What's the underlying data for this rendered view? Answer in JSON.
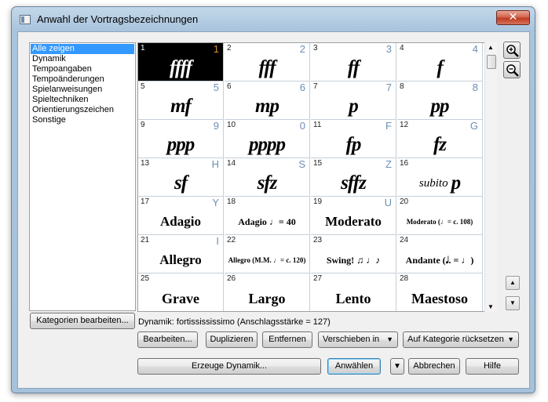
{
  "window": {
    "title": "Anwahl der Vortragsbezeichnungen",
    "close_label": "✕"
  },
  "categories": [
    "Alle zeigen",
    "Dynamik",
    "Tempoangaben",
    "Tempoänderungen",
    "Spielanweisungen",
    "Spieltechniken",
    "Orientierungszeichen",
    "Sonstige"
  ],
  "cells": [
    {
      "n": "1",
      "key": "1",
      "sym": "ffff",
      "style": "dyn"
    },
    {
      "n": "2",
      "key": "2",
      "sym": "fff",
      "style": "dyn"
    },
    {
      "n": "3",
      "key": "3",
      "sym": "ff",
      "style": "dyn"
    },
    {
      "n": "4",
      "key": "4",
      "sym": "f",
      "style": "dyn"
    },
    {
      "n": "5",
      "key": "5",
      "sym": "mf",
      "style": "dyn"
    },
    {
      "n": "6",
      "key": "6",
      "sym": "mp",
      "style": "dyn"
    },
    {
      "n": "7",
      "key": "7",
      "sym": "p",
      "style": "dyn"
    },
    {
      "n": "8",
      "key": "8",
      "sym": "pp",
      "style": "dyn"
    },
    {
      "n": "9",
      "key": "9",
      "sym": "ppp",
      "style": "dyn"
    },
    {
      "n": "10",
      "key": "0",
      "sym": "pppp",
      "style": "dyn"
    },
    {
      "n": "11",
      "key": "F",
      "sym": "fp",
      "style": "dyn"
    },
    {
      "n": "12",
      "key": "G",
      "sym": "fz",
      "style": "dyn"
    },
    {
      "n": "13",
      "key": "H",
      "sym": "sf",
      "style": "dyn"
    },
    {
      "n": "14",
      "key": "S",
      "sym": "sfz",
      "style": "dyn"
    },
    {
      "n": "15",
      "key": "Z",
      "sym": "sffz",
      "style": "dyn"
    },
    {
      "n": "16",
      "key": "",
      "sym": "p",
      "prefix": "subito",
      "style": "dyn"
    },
    {
      "n": "17",
      "key": "Y",
      "sym": "Adagio",
      "style": "tempo"
    },
    {
      "n": "18",
      "key": "",
      "sym": "Adagio ♩= 40",
      "style": "small"
    },
    {
      "n": "19",
      "key": "U",
      "sym": "Moderato",
      "style": "tempo"
    },
    {
      "n": "20",
      "key": "",
      "sym": "Moderato (♩= c. 108)",
      "style": "tiny"
    },
    {
      "n": "21",
      "key": "I",
      "sym": "Allegro",
      "style": "tempo"
    },
    {
      "n": "22",
      "key": "",
      "sym": "Allegro (M.M. ♩= c. 120)",
      "style": "tiny"
    },
    {
      "n": "23",
      "key": "",
      "sym": "Swing! ♫ ♩♪",
      "style": "small"
    },
    {
      "n": "24",
      "key": "",
      "sym": "Andante (𝅗𝅥. = ♩)",
      "style": "small"
    },
    {
      "n": "25",
      "key": "",
      "sym": "Grave",
      "style": "tempo-lg"
    },
    {
      "n": "26",
      "key": "",
      "sym": "Largo",
      "style": "tempo-lg"
    },
    {
      "n": "27",
      "key": "",
      "sym": "Lento",
      "style": "tempo-lg"
    },
    {
      "n": "28",
      "key": "",
      "sym": "Maestoso",
      "style": "tempo-lg"
    }
  ],
  "selected_index": 0,
  "status_text": "Dynamik: fortissississimo (Anschlagsstärke = 127)",
  "buttons": {
    "edit_categories": "Kategorien bearbeiten...",
    "edit": "Bearbeiten...",
    "duplicate": "Duplizieren",
    "remove": "Entfernen",
    "move_to": "Verschieben in",
    "reset_category": "Auf Kategorie rücksetzen",
    "create_dynamic": "Erzeuge Dynamik...",
    "select": "Anwählen",
    "cancel": "Abbrechen",
    "help": "Hilfe"
  }
}
